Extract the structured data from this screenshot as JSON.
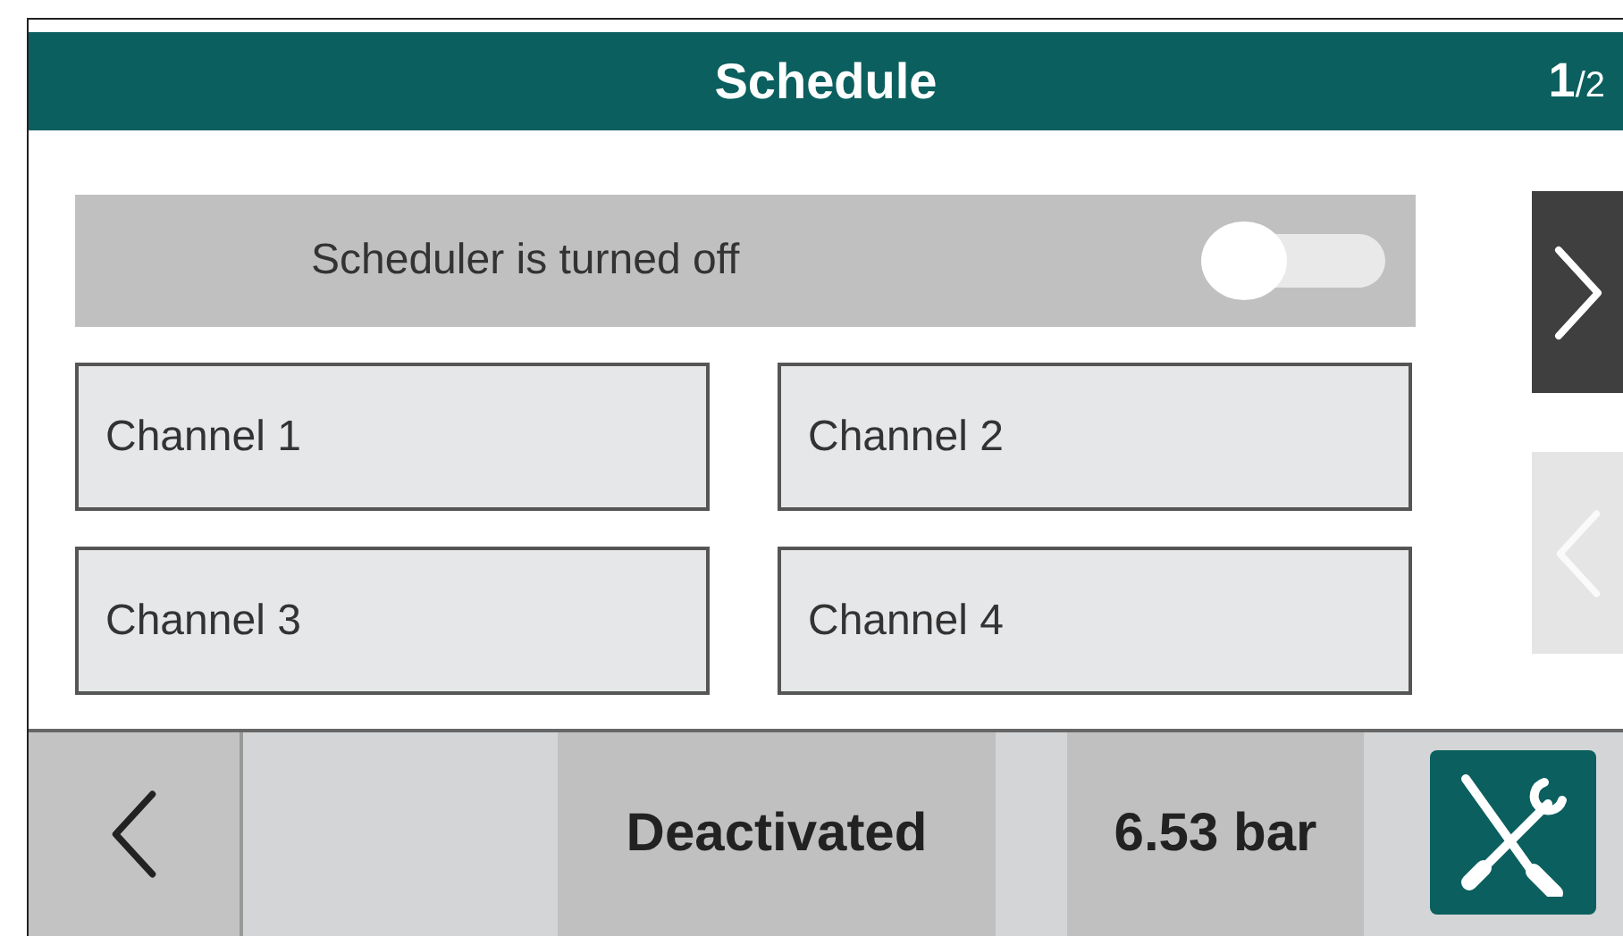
{
  "header": {
    "title": "Schedule",
    "page_current": "1",
    "page_rest": "/2"
  },
  "scheduler": {
    "label": "Scheduler is turned off",
    "on": false
  },
  "channels": [
    {
      "label": "Channel 1"
    },
    {
      "label": "Channel 2"
    },
    {
      "label": "Channel 3"
    },
    {
      "label": "Channel 4"
    }
  ],
  "pager": {
    "next_disabled": false,
    "previous_disabled": true
  },
  "status_bar": {
    "state": "Deactivated",
    "pressure": "6.53 bar"
  }
}
